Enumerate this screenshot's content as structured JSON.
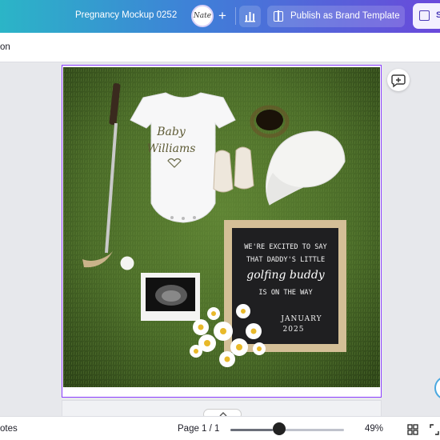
{
  "header": {
    "doc_title": "Pregnancy Mockup 0252",
    "avatar_initials": "Nate",
    "publish_label": "Publish as Brand Template",
    "share_label": "S"
  },
  "toolbar": {
    "left_label": "on"
  },
  "design": {
    "onesie_line1": "Baby",
    "onesie_line2": "Williams",
    "board_line1": "WE'RE EXCITED TO SAY",
    "board_line2": "THAT DADDY'S LITTLE",
    "board_line3": "golfing buddy",
    "board_line4": "IS ON THE WAY",
    "board_line5": "JANUARY",
    "board_line6": "2025"
  },
  "footer": {
    "notes_label": "otes",
    "page_label": "Page 1 / 1",
    "zoom_label": "49%",
    "zoom_value": 49
  },
  "colors": {
    "accent": "#8b3dff",
    "grass": "#4a6b2a"
  }
}
